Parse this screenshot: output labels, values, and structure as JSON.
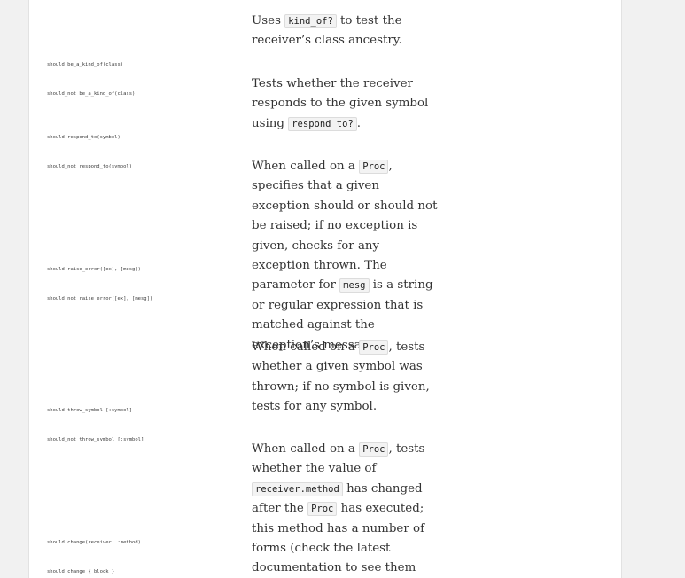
{
  "rows": [
    {
      "code": [
        "should be_a_kind_of(class)",
        "should_not be_a_kind_of(class)"
      ],
      "desc": [
        "Uses ",
        {
          "code": "kind_of?"
        },
        " to test the receiver’s class ancestry."
      ]
    },
    {
      "code": [
        "should respond_to(symbol)",
        "should_not respond_to(symbol)"
      ],
      "desc": [
        "Tests whether the receiver responds to the given symbol using ",
        {
          "code": "respond_to?"
        },
        "."
      ]
    },
    {
      "code": [
        "should raise_error([ex], [mesg])",
        "should_not raise_error([ex], [mesg])"
      ],
      "desc": [
        "When called on a ",
        {
          "code": "Proc"
        },
        ", specifies that a given exception should or should not be raised; if no exception is given, checks for any exception thrown. The parameter for ",
        {
          "code": "mesg"
        },
        " is a string or regular expression that is matched against the exception’s message."
      ]
    },
    {
      "code": [
        "should throw_symbol [:symbol]",
        "should_not throw_symbol [:symbol]"
      ],
      "desc": [
        "When called on a ",
        {
          "code": "Proc"
        },
        ", tests whether a given symbol was thrown; if no symbol is given, tests for any symbol."
      ]
    },
    {
      "code": [
        "should change(receiver, :method)",
        "should change { block }"
      ],
      "desc": [
        "When called on a ",
        {
          "code": "Proc"
        },
        ", tests whether the value of ",
        {
          "code": "receiver.method"
        },
        " has changed after the ",
        {
          "code": "Proc"
        },
        " has executed; this method has a number of forms (check the latest documentation to see them all)."
      ]
    }
  ]
}
